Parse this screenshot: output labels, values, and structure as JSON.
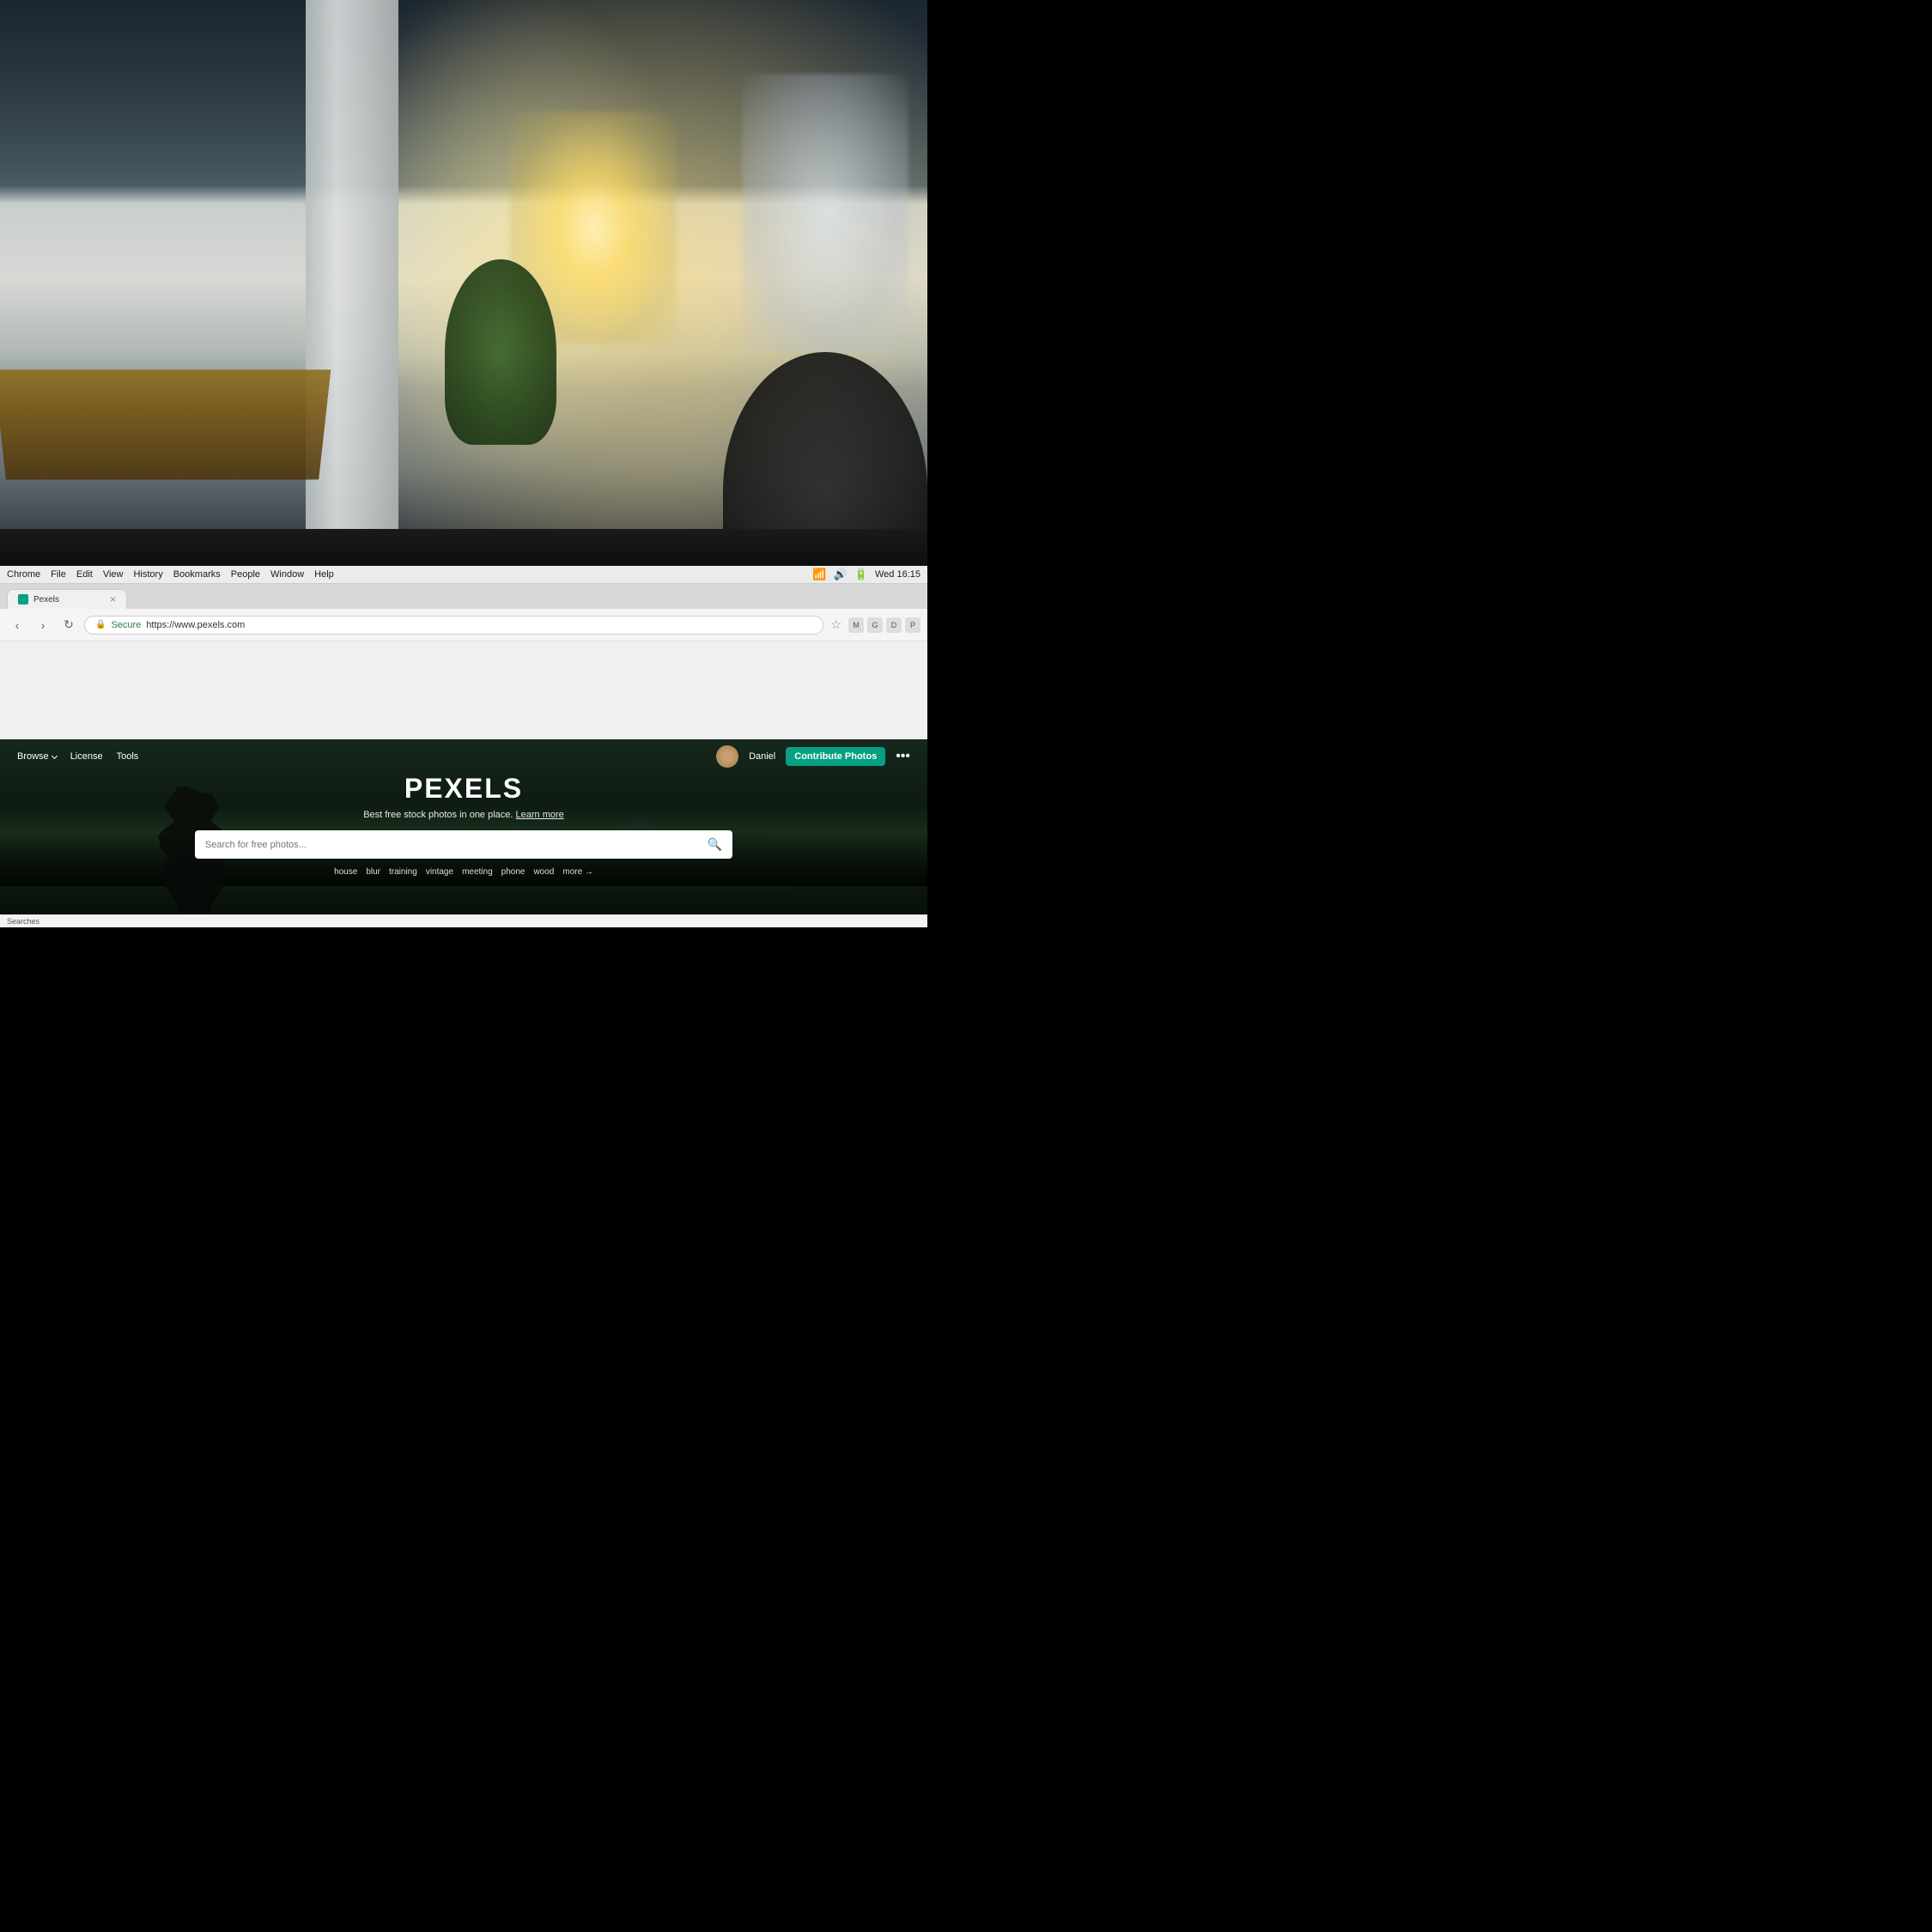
{
  "background": {
    "alt": "Office workspace background photo"
  },
  "menubar": {
    "app": "Chrome",
    "items": [
      "File",
      "Edit",
      "View",
      "History",
      "Bookmarks",
      "People",
      "Window",
      "Help"
    ],
    "time": "Wed 16:15",
    "battery": "100%"
  },
  "browser": {
    "tab": {
      "title": "Pexels",
      "favicon_color": "#05a081"
    },
    "close_button": "×",
    "address": {
      "protocol": "Secure",
      "lock_icon": "🔒",
      "url": "https://www.pexels.com",
      "bookmark_icon": "☆"
    }
  },
  "pexels": {
    "nav": {
      "browse_label": "Browse",
      "license_label": "License",
      "tools_label": "Tools",
      "user_name": "Daniel",
      "contribute_label": "Contribute Photos",
      "more_label": "•••"
    },
    "hero": {
      "logo": "PEXELS",
      "tagline": "Best free stock photos in one place.",
      "learn_more": "Learn more",
      "search_placeholder": "Search for free photos...",
      "quick_tags": [
        "house",
        "blur",
        "training",
        "vintage",
        "meeting",
        "phone",
        "wood"
      ],
      "more_label": "more →"
    }
  },
  "bottom": {
    "searches_label": "Searches"
  }
}
